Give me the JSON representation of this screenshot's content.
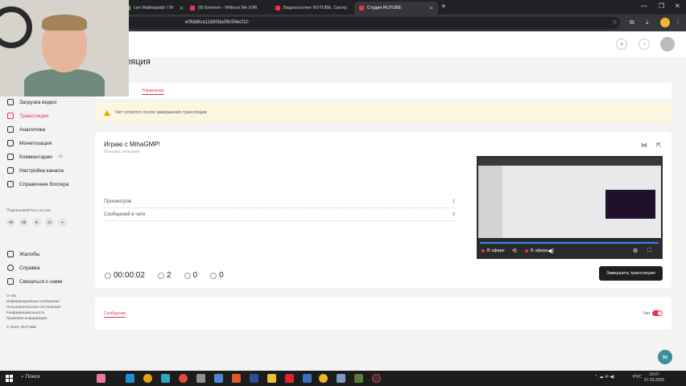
{
  "browser": {
    "tabs": [
      {
        "label": "сил Майнкрафт / М",
        "active": false
      },
      {
        "label": "(8) Eminem - Without Me (Offi",
        "active": false
      },
      {
        "label": "Видеохостинг RUTUBE. Смотр",
        "active": false
      },
      {
        "label": "Студия RUTUBE",
        "active": true
      }
    ],
    "address": "e0fdd6ca11880da09c59ecf10"
  },
  "page": {
    "title": "ляция",
    "tabs": [
      "Управление"
    ],
    "warning": "Чат сотрется после завершения трансляции"
  },
  "sidebar": {
    "items": [
      {
        "label": "Загрузка видео",
        "active": false
      },
      {
        "label": "Трансляции",
        "active": true
      },
      {
        "label": "Аналитика",
        "active": false
      },
      {
        "label": "Монетизация",
        "active": false
      },
      {
        "label": "Комментарии",
        "active": false,
        "badge": "+1"
      },
      {
        "label": "Настройка канала",
        "active": false
      },
      {
        "label": "Справочник блогера",
        "active": false
      }
    ],
    "subscribe_label": "Подписывайтесь на нас",
    "socials": [
      "vk",
      "ok",
      "tg",
      "viber",
      "+"
    ],
    "bottom_items": [
      {
        "label": "Жалобы"
      },
      {
        "label": "Справка"
      },
      {
        "label": "Связаться с нами"
      }
    ],
    "footer_links": [
      "О нас",
      "Информационные сообщения",
      "Пользовательское соглашение",
      "Конфиденциальность",
      "Правовая информация",
      "© 2025, RUTUBE"
    ]
  },
  "stream": {
    "title": "Играю с MihaGMP!",
    "description": "Показать описание",
    "stats": [
      {
        "label": "Просмотров",
        "value": "1"
      },
      {
        "label": "Сообщений в чате",
        "value": "0"
      }
    ],
    "duration": "00:00:02",
    "viewers": "2",
    "likes": "0",
    "dislikes": "0",
    "live_label": "В эфире",
    "end_button": "Завершить трансляцию"
  },
  "chat": {
    "tab": "Сообщения",
    "toggle_label": "Чат",
    "enabled": true
  },
  "taskbar": {
    "search": "Поиск",
    "lang": "РУС",
    "time": "19:07",
    "date": "07.03.2025"
  },
  "colors": {
    "accent": "#e8344e",
    "warning_bg": "#fbf6e0",
    "end_button": "#1f1f1f"
  }
}
